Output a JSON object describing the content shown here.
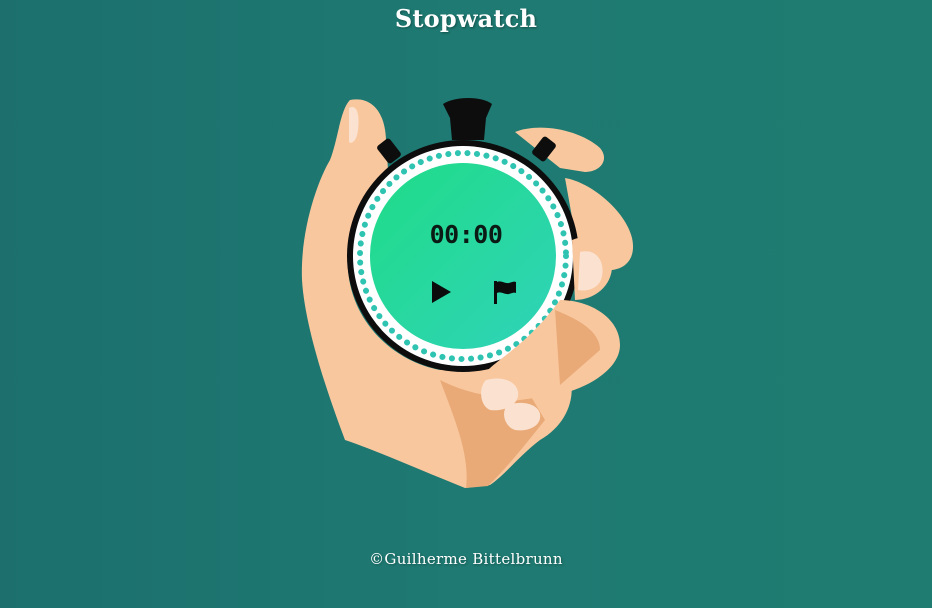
{
  "page": {
    "title": "Stopwatch"
  },
  "stopwatch": {
    "time_display": "00:00",
    "controls": [
      {
        "name": "play",
        "icon": "play-icon"
      },
      {
        "name": "lap",
        "icon": "flag-icon"
      }
    ]
  },
  "footer": {
    "credit": "©Guilherme Bittelbrunn"
  },
  "colors": {
    "background": "#1e7a72",
    "face_gradient_start": "#23db8f",
    "face_gradient_end": "#2bd6b4",
    "skin": "#f9c79e",
    "skin_shadow": "#dfa070",
    "case": "#111111"
  }
}
